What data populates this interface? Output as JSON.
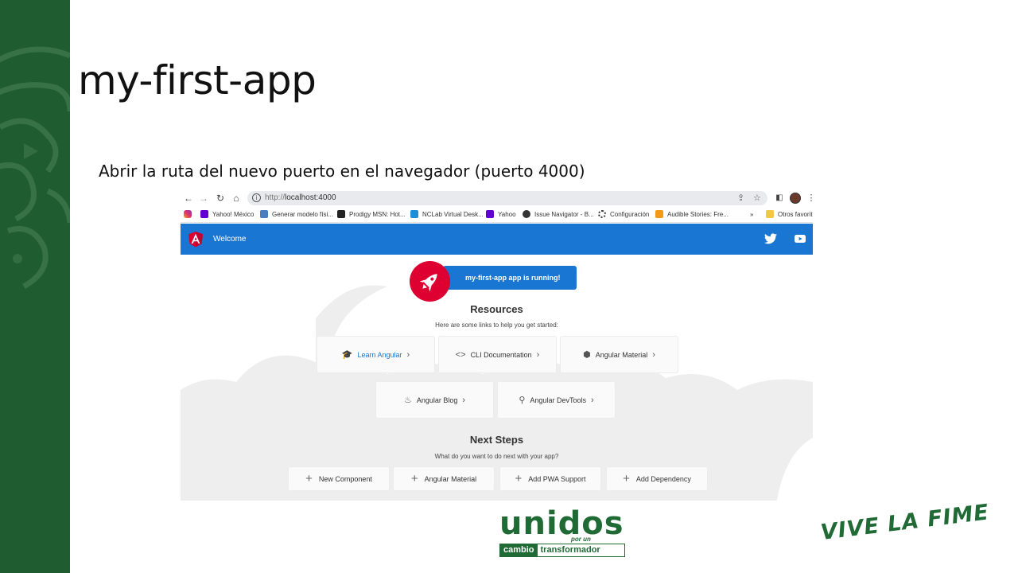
{
  "slide": {
    "title": "my-first-app",
    "subtitle": "Abrir la ruta del nuevo puerto en el navegador (puerto 4000)"
  },
  "browser": {
    "url_scheme": "http://",
    "url_host": "localhost:4000",
    "bookmarks": [
      {
        "label": "Yahoo! México",
        "icon": "yahoo-icon",
        "color": "#6001d2"
      },
      {
        "label": "Generar modelo físi...",
        "icon": "database-icon",
        "color": "#4a7cc0"
      },
      {
        "label": "Prodigy MSN: Hot...",
        "icon": "prodigy-icon",
        "color": "#222222"
      },
      {
        "label": "NCLab Virtual Desk...",
        "icon": "nclab-icon",
        "color": "#1b8fd8"
      },
      {
        "label": "Yahoo",
        "icon": "yahoo-icon",
        "color": "#6001d2"
      },
      {
        "label": "Issue Navigator - B...",
        "icon": "globe-icon",
        "color": "#333333"
      },
      {
        "label": "Configuración",
        "icon": "gear-icon",
        "color": "#333333"
      },
      {
        "label": "Audible Stories: Fre...",
        "icon": "audible-icon",
        "color": "#f39a1b"
      }
    ],
    "bookmarks_more": "»",
    "other_bookmarks": "Otros favorito"
  },
  "app": {
    "toolbar_title": "Welcome",
    "running_text": "my-first-app app is running!",
    "resources_title": "Resources",
    "resources_subtitle": "Here are some links to help you get started:",
    "resources": [
      {
        "label": "Learn Angular",
        "icon": "graduation-cap-icon"
      },
      {
        "label": "CLI Documentation",
        "icon": "code-icon"
      },
      {
        "label": "Angular Material",
        "icon": "material-shield-icon"
      },
      {
        "label": "Angular Blog",
        "icon": "flame-icon"
      },
      {
        "label": "Angular DevTools",
        "icon": "search-gear-icon"
      }
    ],
    "next_steps_title": "Next Steps",
    "next_steps_subtitle": "What do you want to do next with your app?",
    "next_steps": [
      {
        "label": "New Component"
      },
      {
        "label": "Angular Material"
      },
      {
        "label": "Add PWA Support"
      },
      {
        "label": "Add Dependency"
      }
    ]
  },
  "footer": {
    "unidos_word": "unidos",
    "unidos_porun": "por un",
    "unidos_cambio": "cambio",
    "unidos_transformador": "transformador",
    "vive": "VIVE LA FIME"
  },
  "colors": {
    "band": "#1f5c30",
    "angular_blue": "#1976d2",
    "angular_red": "#dd0031",
    "fime_green": "#1f6a35"
  }
}
